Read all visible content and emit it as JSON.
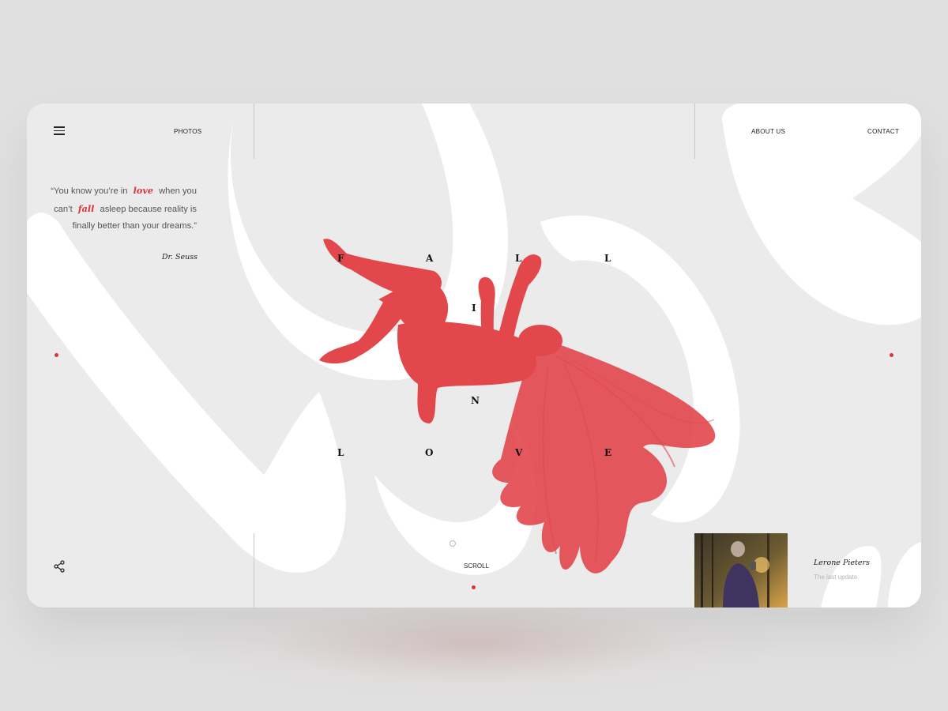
{
  "nav": {
    "photos": "PHOTOS",
    "about": "ABOUT US",
    "contact": "CONTACT"
  },
  "quote": {
    "part1": "“You know you’re in",
    "word1": "love",
    "part2": "when you can’t",
    "word2": "fall",
    "part3": "asleep because reality is finally better than your dreams.”",
    "author": "Dr. Seuss"
  },
  "headline": {
    "row1": [
      "F",
      "A",
      "L",
      "L"
    ],
    "row2": [
      "I",
      "N"
    ],
    "row3": [
      "L",
      "O",
      "V",
      "E"
    ]
  },
  "background_word": "love",
  "scroll_label": "SCROLL",
  "featured": {
    "name": "Lerone Pieters",
    "caption": "The last update"
  },
  "icons": {
    "menu": "hamburger-menu-icon",
    "share": "share-icon"
  },
  "colors": {
    "accent": "#d8353a",
    "figure": "#e2474c",
    "background": "#ebebeb"
  }
}
